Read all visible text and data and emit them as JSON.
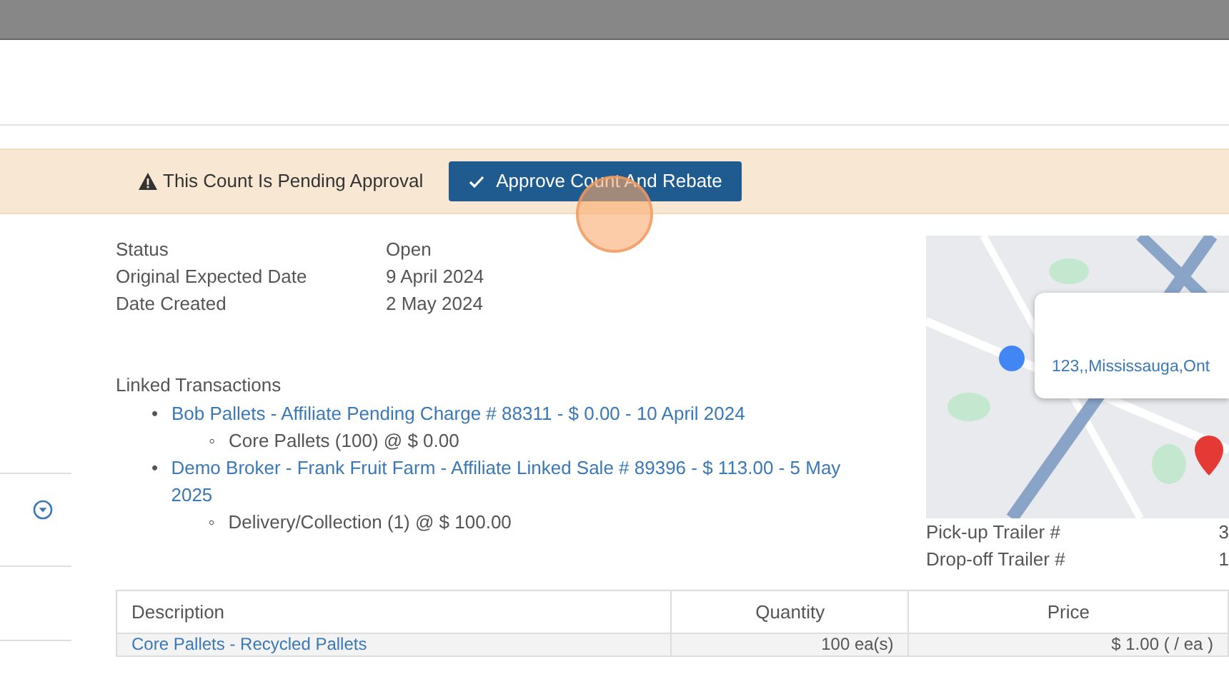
{
  "alert": {
    "message": "This Count Is Pending Approval",
    "button": "Approve Count And Rebate"
  },
  "details": [
    {
      "label": "Status",
      "value": "Open"
    },
    {
      "label": "Original Expected Date",
      "value": "9 April 2024"
    },
    {
      "label": "Date Created",
      "value": "2 May 2024"
    }
  ],
  "linked_transactions": {
    "title": "Linked Transactions",
    "items": [
      {
        "marker": "•",
        "link": "Bob Pallets - Affiliate Pending Charge # 88311 - $ 0.00 - 10 April 2024",
        "lines": [
          {
            "marker": "◦",
            "text": "Core Pallets (100) @ $ 0.00"
          }
        ]
      },
      {
        "marker": "•",
        "link": "Demo Broker - Frank Fruit Farm - Affiliate Linked Sale # 89396 - $ 113.00 - 5 May 2025",
        "lines": [
          {
            "marker": "◦",
            "text": "Delivery/Collection (1) @ $ 100.00"
          }
        ]
      }
    ]
  },
  "map": {
    "kind": "picture",
    "popup": "123,,Mississauga,Ont"
  },
  "trailers": [
    {
      "label": "Pick-up Trailer #",
      "value": "3"
    },
    {
      "label": "Drop-off Trailer #",
      "value": "1"
    }
  ],
  "table": {
    "columns": [
      "Description",
      "Quantity",
      "Price"
    ],
    "rows": [
      [
        "Core Pallets - Recycled Pallets",
        "100 ea(s)",
        "$ 1.00 ( / ea )"
      ]
    ]
  }
}
